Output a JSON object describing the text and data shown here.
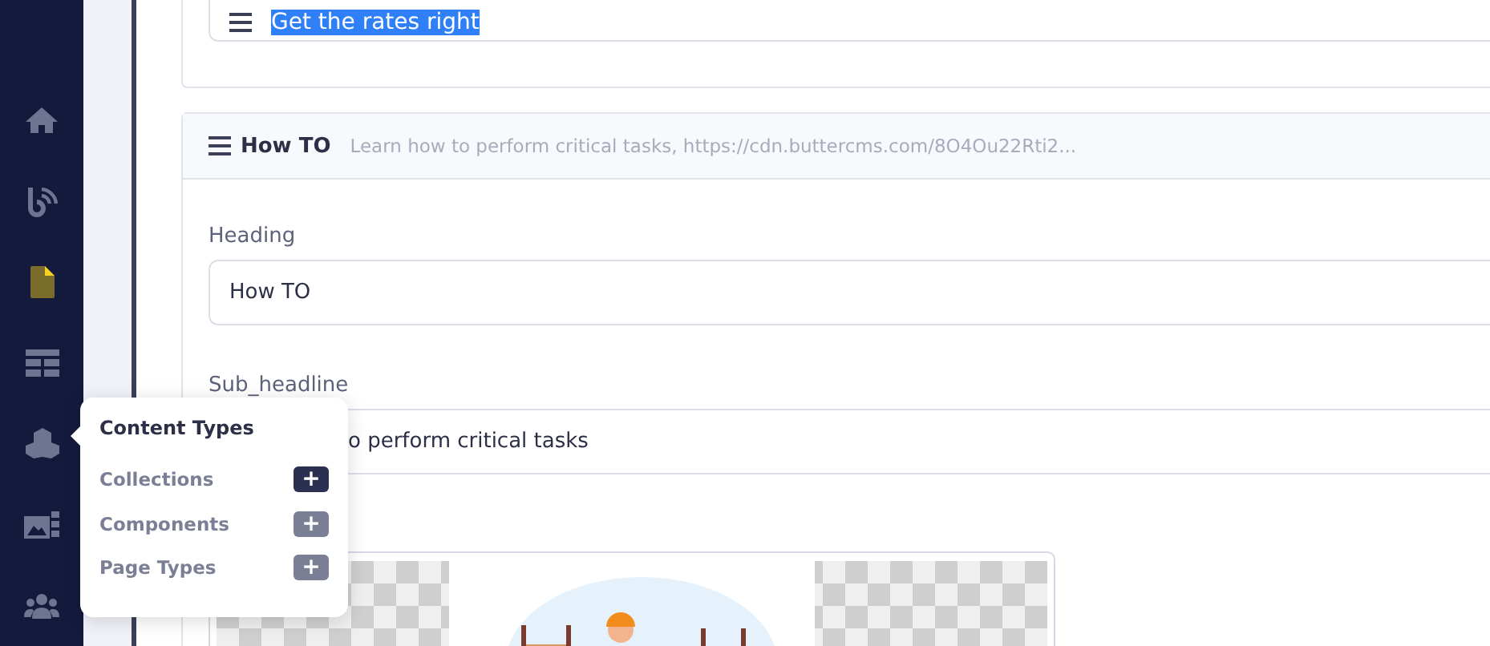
{
  "sidebar": {
    "items": [
      {
        "selected": false
      },
      {
        "selected": false
      },
      {
        "selected": true
      },
      {
        "selected": false
      },
      {
        "selected": false
      },
      {
        "selected": false
      },
      {
        "selected": false
      }
    ]
  },
  "top_field": {
    "value": "Get the rates right",
    "highlighted": true
  },
  "section": {
    "title": "How TO",
    "summary": "Learn how to perform critical tasks, https://cdn.buttercms.com/8O4Ou22Rti2...",
    "fields": [
      {
        "label": "Heading",
        "value": "How TO"
      },
      {
        "label": "Sub_headline",
        "value": "o perform critical tasks"
      }
    ]
  },
  "popover": {
    "title": "Content Types",
    "items": [
      {
        "label": "Collections",
        "selected": true
      },
      {
        "label": "Components",
        "selected": false
      },
      {
        "label": "Page Types",
        "selected": false
      }
    ],
    "add": "+"
  }
}
